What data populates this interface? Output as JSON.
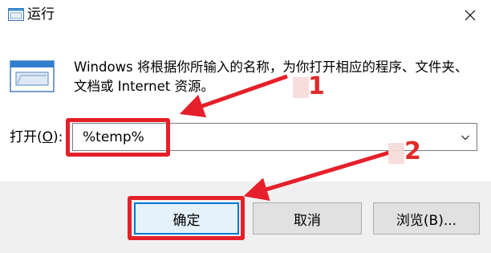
{
  "window": {
    "title": "运行",
    "app_icon": "run-dialog-icon",
    "close_icon": "close-icon"
  },
  "description": "Windows 将根据你所输入的名称，为你打开相应的程序、文件夹、文档或 Internet 资源。",
  "open_label": {
    "prefix": "打开(",
    "accel": "O",
    "suffix": "):"
  },
  "command_input": {
    "value": "%temp%",
    "dropdown_icon": "chevron-down-icon"
  },
  "buttons": {
    "ok": "确定",
    "cancel": "取消",
    "browse": "浏览(B)..."
  },
  "annotations": {
    "step1": "1",
    "step2": "2",
    "highlight_color": "#e5202a"
  }
}
